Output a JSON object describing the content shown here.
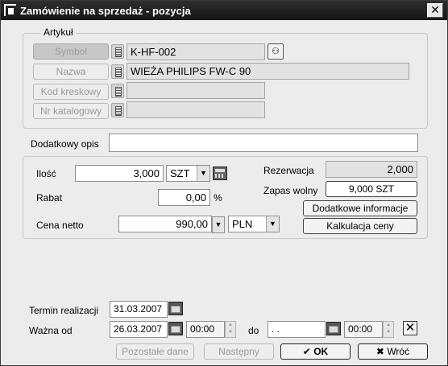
{
  "window": {
    "title": "Zamówienie na sprzedaż - pozycja",
    "close_label": "✕"
  },
  "artykul": {
    "group_label": "Artykuł",
    "symbol": {
      "button": "Symbol",
      "value": "K-HF-002"
    },
    "nazwa": {
      "button": "Nazwa",
      "value": "WIEŻA PHILIPS FW-C 90"
    },
    "kod_kreskowy": {
      "button": "Kod kreskowy",
      "value": ""
    },
    "nr_katalogowy": {
      "button": "Nr katalogowy",
      "value": ""
    }
  },
  "dodatkowy_opis": {
    "label": "Dodatkowy opis",
    "value": ""
  },
  "pozycja": {
    "ilosc_label": "Ilość",
    "ilosc_value": "3,000",
    "jednostka": "SZT",
    "rabat_label": "Rabat",
    "rabat_value": "0,00",
    "rabat_unit": "%",
    "cena_label": "Cena netto",
    "cena_value": "990,00",
    "waluta": "PLN",
    "rezerwacja_label": "Rezerwacja",
    "rezerwacja_value": "2,000",
    "zapas_label": "Zapas wolny",
    "zapas_button": "9,000 SZT",
    "dodatkowe_informacje": "Dodatkowe informacje",
    "kalkulacja_ceny": "Kalkulacja ceny"
  },
  "termin": {
    "label": "Termin realizacji",
    "value": "31.03.2007"
  },
  "wazna": {
    "label": "Ważna od",
    "od_date": "26.03.2007",
    "od_time": "00:00",
    "do_label": "do",
    "do_date": " .  .",
    "do_time": "00:00"
  },
  "buttons": {
    "pozostale": "Pozostałe dane",
    "nastepny": "Następny",
    "ok": "OK",
    "wroc": "Wróć"
  }
}
